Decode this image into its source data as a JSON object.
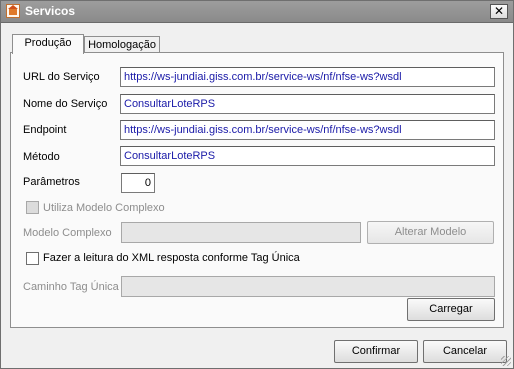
{
  "window": {
    "title": "Servicos",
    "close_glyph": "✕"
  },
  "tabs": [
    {
      "label": "Produção",
      "active": true
    },
    {
      "label": "Homologação",
      "active": false
    }
  ],
  "form": {
    "url_label": "URL do Serviço",
    "url_value": "https://ws-jundiai.giss.com.br/service-ws/nf/nfse-ws?wsdl",
    "nome_label": "Nome do Serviço",
    "nome_value": "ConsultarLoteRPS",
    "endpoint_label": "Endpoint",
    "endpoint_value": "https://ws-jundiai.giss.com.br/service-ws/nf/nfse-ws?wsdl",
    "metodo_label": "Método",
    "metodo_value": "ConsultarLoteRPS",
    "parametros_label": "Parâmetros",
    "parametros_value": "0",
    "complexo_check_label": "Utiliza Modelo Complexo",
    "modelo_label": "Modelo Complexo",
    "modelo_value": "",
    "alterar_button": "Alterar Modelo",
    "xml_check_label": "Fazer a leitura do XML resposta conforme Tag Única",
    "caminho_label": "Caminho Tag Única",
    "caminho_value": "",
    "carregar_button": "Carregar"
  },
  "footer": {
    "confirm_button": "Confirmar",
    "cancel_button": "Cancelar"
  }
}
